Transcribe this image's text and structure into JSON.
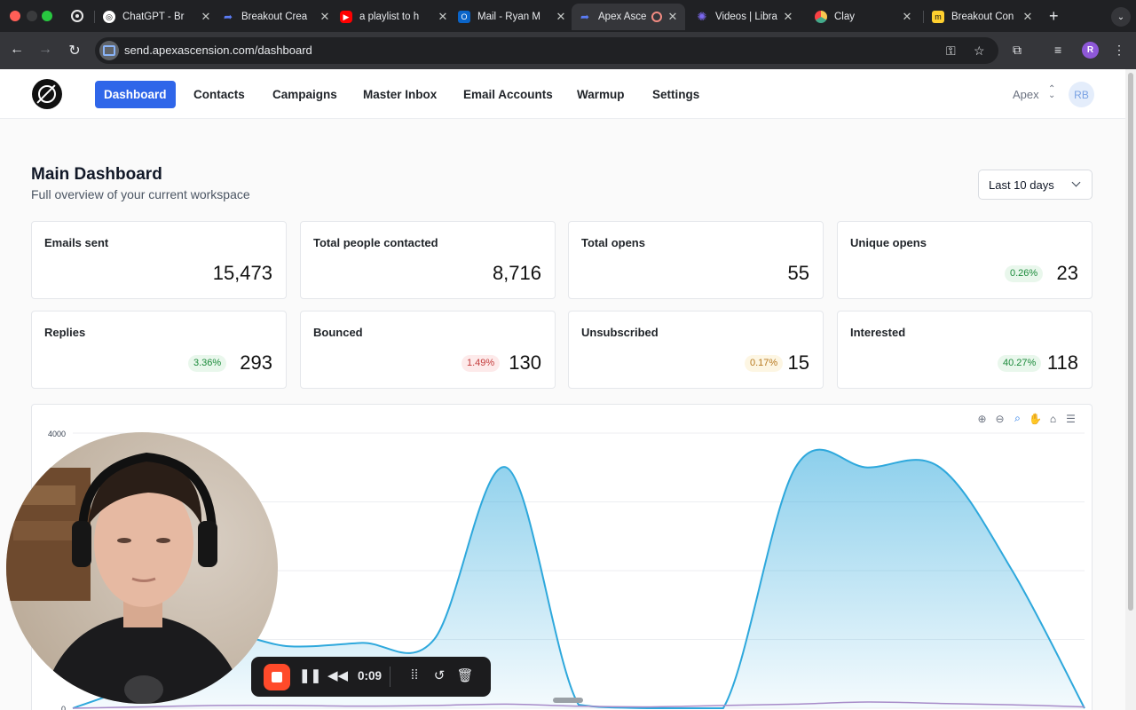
{
  "browser": {
    "tabs": [
      {
        "title": "ChatGPT - Br",
        "favicon": "openai-icon"
      },
      {
        "title": "Breakout Crea",
        "favicon": "breakout-icon"
      },
      {
        "title": "a playlist to h",
        "favicon": "youtube-icon"
      },
      {
        "title": "Mail - Ryan M",
        "favicon": "outlook-icon"
      },
      {
        "title": "Apex Asce",
        "favicon": "apex-icon",
        "active": true,
        "recording": true
      },
      {
        "title": "Videos | Libra",
        "favicon": "loom-icon"
      },
      {
        "title": "Clay",
        "favicon": "clay-icon"
      },
      {
        "title": "Breakout Con",
        "favicon": "miro-icon"
      }
    ],
    "url": "send.apexascension.com/dashboard",
    "profile_initial": "R"
  },
  "nav": {
    "items": [
      "Dashboard",
      "Contacts",
      "Campaigns",
      "Master Inbox",
      "Email Accounts",
      "Warmup",
      "Settings"
    ],
    "active": "Dashboard",
    "workspace": "Apex",
    "avatar": "RB"
  },
  "header": {
    "title": "Main Dashboard",
    "subtitle": "Full overview of your current workspace",
    "range": "Last 10 days"
  },
  "stats": [
    {
      "label": "Emails sent",
      "value": "15,473",
      "badge": null
    },
    {
      "label": "Total people contacted",
      "value": "8,716",
      "badge": null
    },
    {
      "label": "Total opens",
      "value": "55",
      "badge": null
    },
    {
      "label": "Unique opens",
      "value": "23",
      "badge": "0.26%",
      "badge_color": "green"
    },
    {
      "label": "Replies",
      "value": "293",
      "badge": "3.36%",
      "badge_color": "green"
    },
    {
      "label": "Bounced",
      "value": "130",
      "badge": "1.49%",
      "badge_color": "red"
    },
    {
      "label": "Unsubscribed",
      "value": "15",
      "badge": "0.17%",
      "badge_color": "amber"
    },
    {
      "label": "Interested",
      "value": "118",
      "badge": "40.27%",
      "badge_color": "green"
    }
  ],
  "chart_data": {
    "type": "area",
    "ylim": [
      0,
      4000
    ],
    "yticks": [
      "4000",
      "0"
    ],
    "grid": true,
    "series": [
      {
        "values": [
          0,
          400,
          1050,
          900,
          950,
          1000,
          3500,
          50,
          0,
          0,
          3500,
          3500,
          3500,
          2000,
          0
        ],
        "color": "#2ea8dc"
      },
      {
        "values": [
          0,
          20,
          40,
          40,
          30,
          40,
          60,
          30,
          20,
          40,
          60,
          90,
          70,
          50,
          20
        ],
        "color": "#a78bc9"
      }
    ],
    "toolbar": [
      "zoom-in-icon",
      "zoom-out-icon",
      "selection-zoom-icon",
      "pan-icon",
      "reset-home-icon",
      "menu-icon"
    ]
  },
  "recorder": {
    "time": "0:09"
  },
  "colors": {
    "accent": "#2f66e9",
    "area": "#2ea8dc"
  }
}
